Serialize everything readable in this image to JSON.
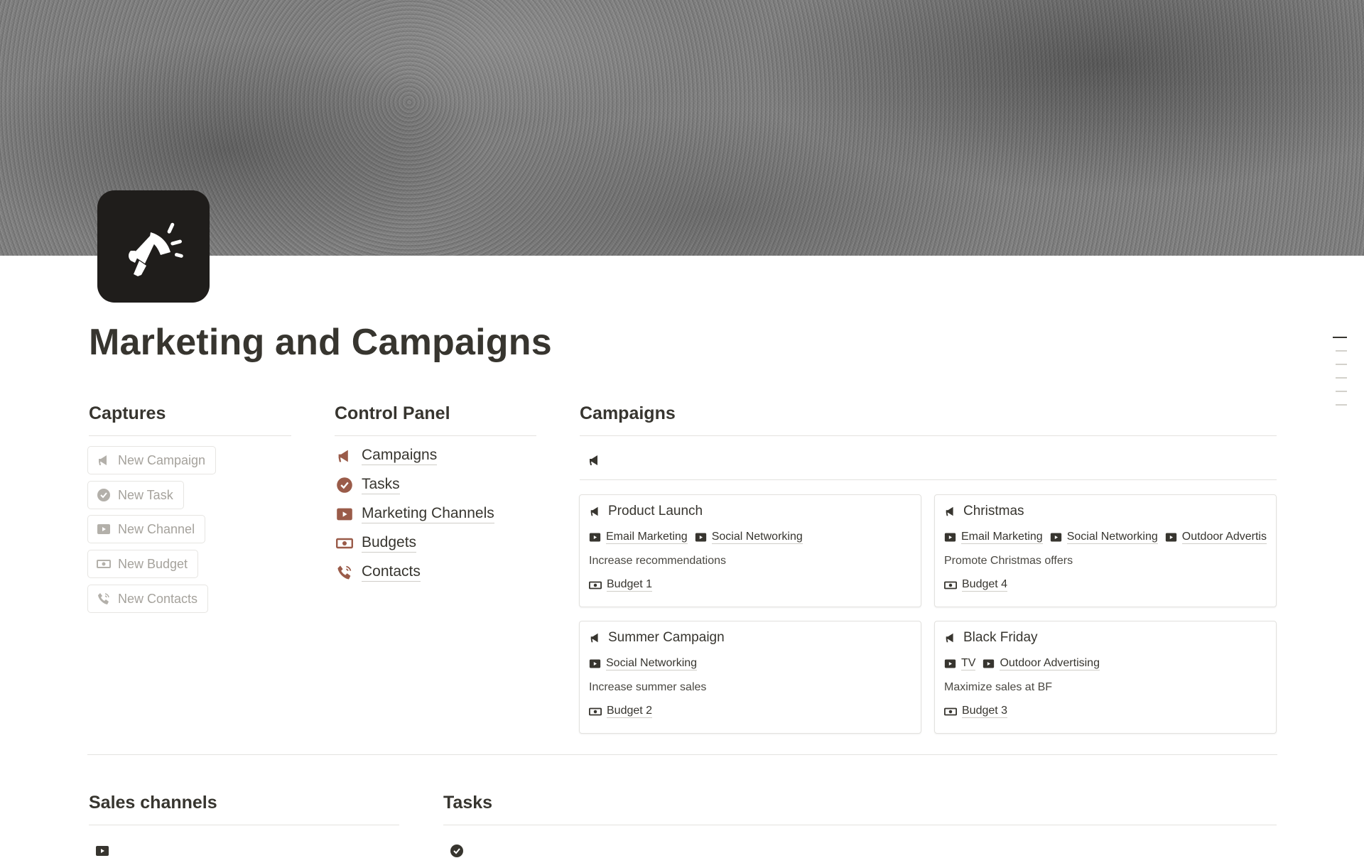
{
  "page": {
    "title": "Marketing and Campaigns"
  },
  "captures": {
    "heading": "Captures",
    "buttons": [
      {
        "label": "New Campaign",
        "icon": "megaphone-icon"
      },
      {
        "label": "New Task",
        "icon": "check-circle-icon"
      },
      {
        "label": "New Channel",
        "icon": "play-screen-icon"
      },
      {
        "label": "New Budget",
        "icon": "money-icon"
      },
      {
        "label": "New Contacts",
        "icon": "phone-icon"
      }
    ]
  },
  "control_panel": {
    "heading": "Control Panel",
    "items": [
      {
        "label": "Campaigns",
        "icon": "megaphone-icon"
      },
      {
        "label": "Tasks",
        "icon": "check-circle-icon"
      },
      {
        "label": "Marketing Channels",
        "icon": "play-screen-icon"
      },
      {
        "label": "Budgets",
        "icon": "money-icon"
      },
      {
        "label": "Contacts",
        "icon": "phone-icon"
      }
    ]
  },
  "campaigns": {
    "heading": "Campaigns",
    "cards": [
      {
        "title": "Product Launch",
        "channels": [
          "Email Marketing",
          "Social Networking"
        ],
        "goal": "Increase recommendations",
        "budget": "Budget 1"
      },
      {
        "title": "Christmas",
        "channels": [
          "Email Marketing",
          "Social Networking",
          "Outdoor Advertis"
        ],
        "goal": "Promote Christmas offers",
        "budget": "Budget 4"
      },
      {
        "title": "Summer Campaign",
        "channels": [
          "Social Networking"
        ],
        "goal": "Increase summer sales",
        "budget": "Budget 2"
      },
      {
        "title": "Black Friday",
        "channels": [
          "TV",
          "Outdoor Advertising"
        ],
        "goal": "Maximize sales at BF",
        "budget": "Budget 3"
      }
    ]
  },
  "sales_channels": {
    "heading": "Sales channels"
  },
  "tasks": {
    "heading": "Tasks"
  },
  "colors": {
    "accent_icon": "#9a5b49",
    "muted_icon": "#b3b0aa",
    "text": "#37352f"
  }
}
